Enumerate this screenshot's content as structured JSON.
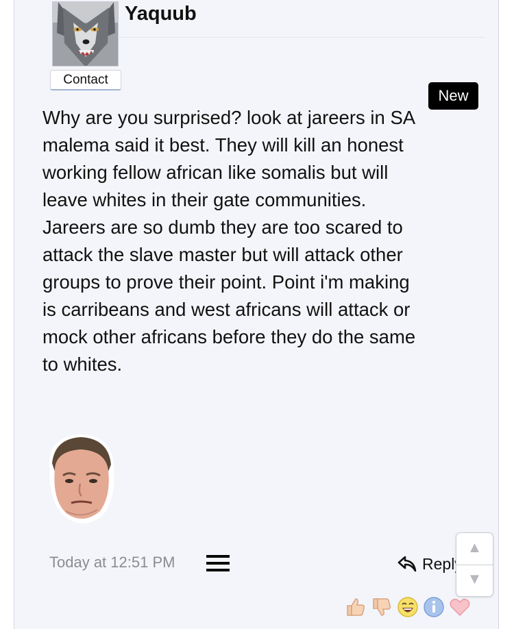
{
  "post": {
    "author": "Yaquub",
    "contact_label": "Contact",
    "new_badge": "New",
    "body": "Why are you surprised? look at jareers in SA malema said it best. They will kill an honest working fellow african like somalis but will leave whites in their gate communities. Jareers are so dumb they are too scared to attack the slave master but will attack other groups to prove their point. Point i'm making is carribeans and west africans will attack or mock other africans before they do the same to whites.",
    "timestamp": "Today at 12:51 PM",
    "reply_label": "Reply"
  },
  "icons": {
    "avatar": "wolf-avatar",
    "menu": "hamburger-menu-icon",
    "reply": "reply-arrow-icon",
    "scroll_up": "triangle-up-icon",
    "scroll_down": "triangle-down-icon",
    "reactions": [
      "thumbs-up-icon",
      "thumbs-down-icon",
      "laughing-face-icon",
      "info-icon",
      "heart-icon"
    ]
  },
  "colors": {
    "background": "#f4f5fa",
    "badge": "#000000",
    "timestamp": "#8a8c92"
  }
}
